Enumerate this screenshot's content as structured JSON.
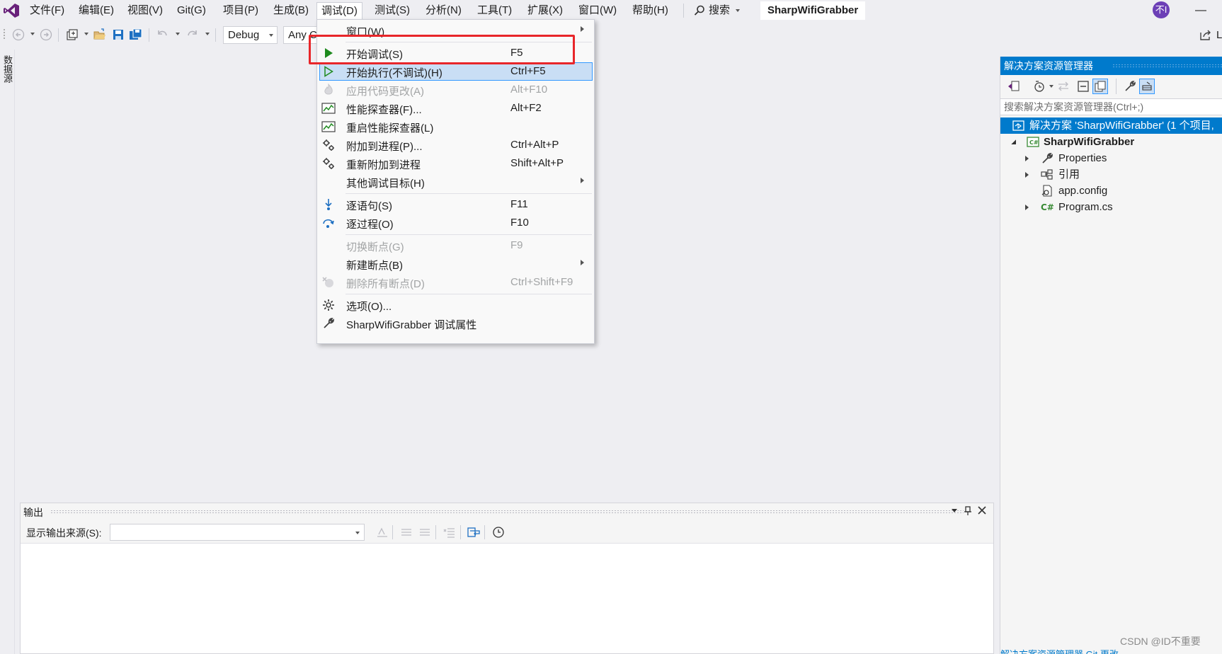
{
  "menubar": {
    "items": [
      "文件(F)",
      "编辑(E)",
      "视图(V)",
      "Git(G)",
      "项目(P)",
      "生成(B)",
      "调试(D)",
      "测试(S)",
      "分析(N)",
      "工具(T)",
      "扩展(X)",
      "窗口(W)",
      "帮助(H)"
    ],
    "search_label": "搜索",
    "project_title": "SharpWifiGrabber",
    "avatar_text": "不I",
    "minimize": "—"
  },
  "toolbar": {
    "config": "Debug",
    "platform": "Any C",
    "share_label": "L"
  },
  "left_tab": "数据源",
  "debug_menu": {
    "items": [
      {
        "label": "窗口(W)",
        "shortcut": ""
      },
      {
        "label": "开始调试(S)",
        "shortcut": "F5"
      },
      {
        "label": "开始执行(不调试)(H)",
        "shortcut": "Ctrl+F5"
      },
      {
        "label": "应用代码更改(A)",
        "shortcut": "Alt+F10"
      },
      {
        "label": "性能探查器(F)...",
        "shortcut": "Alt+F2"
      },
      {
        "label": "重启性能探查器(L)",
        "shortcut": ""
      },
      {
        "label": "附加到进程(P)...",
        "shortcut": "Ctrl+Alt+P"
      },
      {
        "label": "重新附加到进程",
        "shortcut": "Shift+Alt+P"
      },
      {
        "label": "其他调试目标(H)",
        "shortcut": ""
      },
      {
        "label": "逐语句(S)",
        "shortcut": "F11"
      },
      {
        "label": "逐过程(O)",
        "shortcut": "F10"
      },
      {
        "label": "切换断点(G)",
        "shortcut": "F9"
      },
      {
        "label": "新建断点(B)",
        "shortcut": ""
      },
      {
        "label": "删除所有断点(D)",
        "shortcut": "Ctrl+Shift+F9"
      },
      {
        "label": "选项(O)...",
        "shortcut": ""
      },
      {
        "label": "SharpWifiGrabber 调试属性",
        "shortcut": ""
      }
    ]
  },
  "output": {
    "title": "输出",
    "source_label": "显示输出来源(S):",
    "source_value": ""
  },
  "solution_explorer": {
    "title": "解决方案资源管理器",
    "search_placeholder": "搜索解决方案资源管理器(Ctrl+;)",
    "tree": [
      {
        "label": "解决方案 'SharpWifiGrabber' (1 个项目,"
      },
      {
        "label": "SharpWifiGrabber"
      },
      {
        "label": "Properties"
      },
      {
        "label": "引用"
      },
      {
        "label": "app.config"
      },
      {
        "label": "Program.cs"
      }
    ],
    "bottom_tabs": "解决方案资源管理器   Git 更改"
  },
  "watermark": "CSDN @ID不重要",
  "colors": {
    "accent": "#007acc",
    "highlight_box": "#e8262a",
    "menu_hover": "#c9def5",
    "play_green": "#1e8a1e"
  }
}
